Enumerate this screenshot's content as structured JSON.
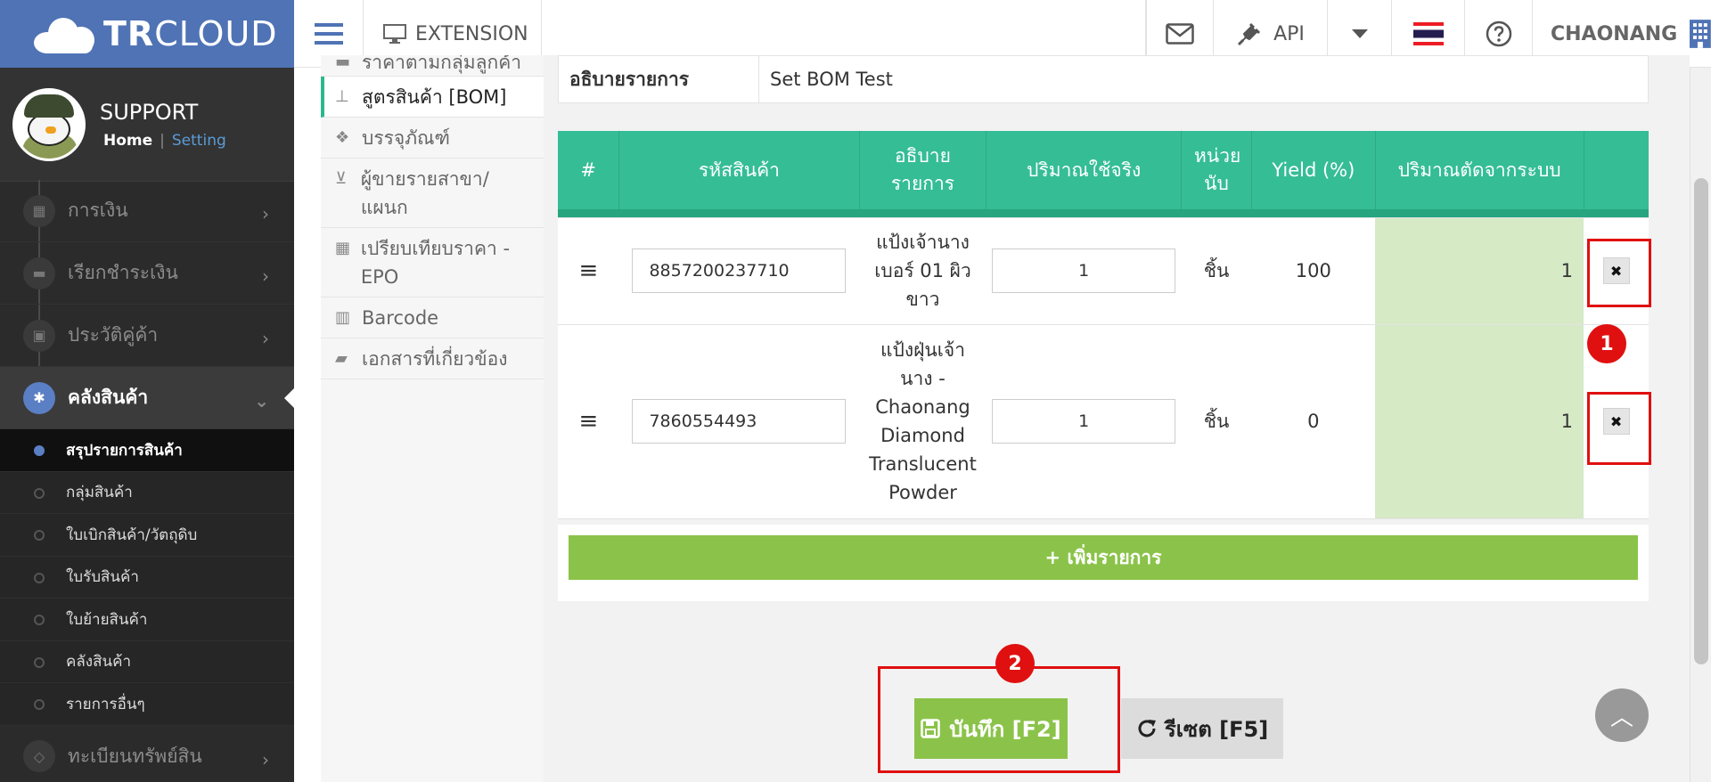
{
  "brand": {
    "name_bold": "TR",
    "name_light": "CLOUD"
  },
  "profile": {
    "role": "SUPPORT",
    "home": "Home",
    "separator": "|",
    "setting": "Setting"
  },
  "sidebar": {
    "items_top": [
      {
        "label": "การเงิน",
        "icon": "calendar-icon"
      },
      {
        "label": "เรียกชำระเงิน",
        "icon": "credit-card-icon"
      },
      {
        "label": "ประวัติคู่ค้า",
        "icon": "contact-book-icon"
      }
    ],
    "active": {
      "label": "คลังสินค้า",
      "icon": "cubes-icon"
    },
    "subitems": [
      {
        "label": "สรุปรายการสินค้า"
      },
      {
        "label": "กลุ่มสินค้า"
      },
      {
        "label": "ใบเบิกสินค้า/วัตถุดิบ"
      },
      {
        "label": "ใบรับสินค้า"
      },
      {
        "label": "ใบย้ายสินค้า"
      },
      {
        "label": "คลังสินค้า"
      },
      {
        "label": "รายการอื่นๆ"
      }
    ],
    "bottom": {
      "label": "ทะเบียนทรัพย์สิน",
      "icon": "diamond-icon"
    }
  },
  "topbar": {
    "extension": "EXTENSION",
    "api": "API",
    "user": "CHAONANG"
  },
  "subnav": [
    {
      "label": "ราคาตามกลุ่มลูกค้า",
      "icon": "tag-icon"
    },
    {
      "label": "สูตรสินค้า [BOM]",
      "icon": "sitemap-icon"
    },
    {
      "label": "บรรจุภัณฑ์",
      "icon": "dropbox-icon"
    },
    {
      "label": "ผู้ขายรายสาขา/แผนก",
      "icon": "cart-icon"
    },
    {
      "label": "เปรียบเทียบราคา - EPO",
      "icon": "table-icon"
    },
    {
      "label": "Barcode",
      "icon": "barcode-icon"
    },
    {
      "label": "เอกสารที่เกี่ยวข้อง",
      "icon": "folder-icon"
    }
  ],
  "description": {
    "label": "อธิบายรายการ",
    "value": "Set BOM Test"
  },
  "table": {
    "headers": [
      "#",
      "รหัสสินค้า",
      "อธิบายรายการ",
      "ปริมาณใช้จริง",
      "หน่วยนับ",
      "Yield (%)",
      "ปริมาณตัดจากระบบ"
    ],
    "rows": [
      {
        "code": "8857200237710",
        "description": "แป้งเจ้านาง เบอร์ 01 ผิวขาว",
        "qty": "1",
        "unit": "ชิ้น",
        "yield": "100",
        "cut": "1"
      },
      {
        "code": "7860554493",
        "description": "แป้งฝุ่นเจ้านาง - Chaonang Diamond Translucent Powder",
        "qty": "1",
        "unit": "ชิ้น",
        "yield": "0",
        "cut": "1"
      }
    ],
    "delete_symbol": "✖"
  },
  "buttons": {
    "add": "+ เพิ่มรายการ",
    "save": "บันทึก [F2]",
    "reset": "รีเซต [F5]"
  },
  "annotations": {
    "one": "1",
    "two": "2"
  },
  "colors": {
    "brand": "#4f73b5",
    "header_green": "#35bd96",
    "button_green": "#8bc34a",
    "annotation_red": "#e01010"
  }
}
